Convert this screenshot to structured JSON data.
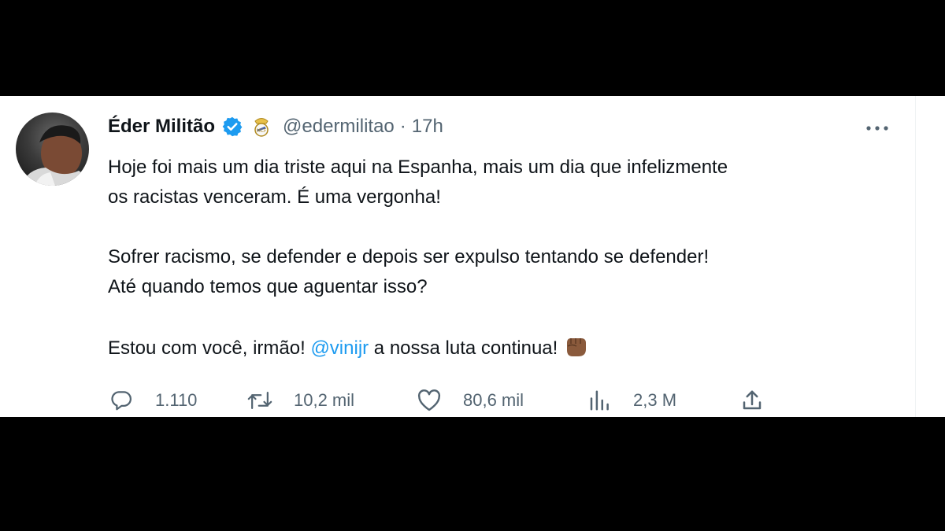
{
  "author": {
    "display_name": "Éder Militão",
    "handle": "@edermilitao",
    "separator": "·",
    "time": "17h",
    "verified_color": "#1d9bf0"
  },
  "menu": {
    "more_label": "···"
  },
  "tweet": {
    "line1": "Hoje foi mais um dia triste aqui na Espanha, mais um dia que infelizmente",
    "line2": "os racistas venceram. É uma vergonha!",
    "line3": "Sofrer racismo, se defender e depois ser expulso tentando se defender!",
    "line4": "Até quando temos que aguentar isso?",
    "line5_before": "Estou com você, irmão! ",
    "mention": "@vinijr",
    "line5_after": " a nossa luta continua!",
    "emoji": "fist-emoji"
  },
  "actions": {
    "replies": "1.110",
    "retweets": "10,2 mil",
    "likes": "80,6 mil",
    "views": "2,3 M"
  },
  "colors": {
    "text": "#0f1419",
    "secondary": "#536471",
    "link": "#1d9bf0",
    "background": "#ffffff",
    "letterbox": "#000000"
  }
}
